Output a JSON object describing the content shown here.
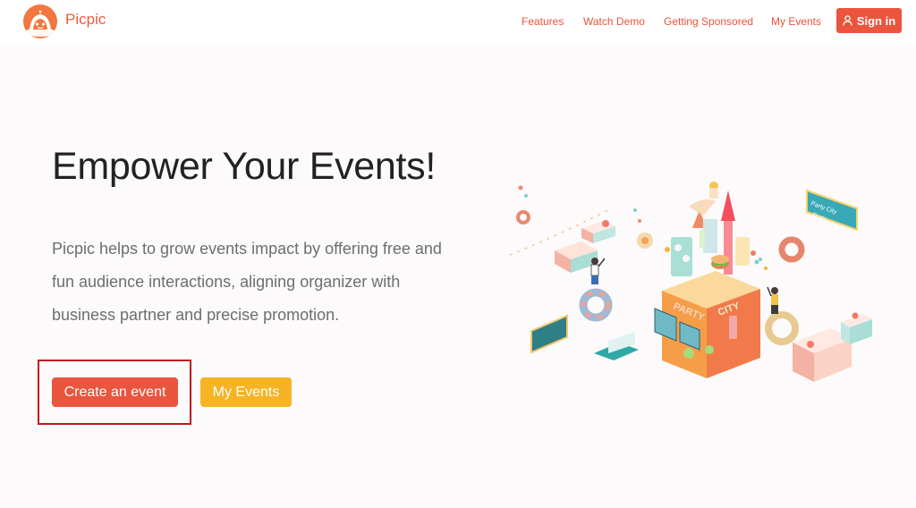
{
  "brand": {
    "name": "Picpic",
    "logo_icon": "picpic-logo-icon"
  },
  "nav": {
    "links": [
      "Features",
      "Watch Demo",
      "Getting Sponsored",
      "My Events"
    ],
    "signin_label": "Sign in",
    "signin_icon": "user-icon"
  },
  "hero": {
    "title": "Empower Your Events!",
    "description_lines": [
      "Picpic helps to grow events impact by offering free and",
      "fun audience interactions, aligning organizer with",
      "business partner and precise promotion."
    ],
    "create_button": "Create an event",
    "my_events_button": "My Events"
  },
  "illustration": {
    "sign_lines": [
      "Party City",
      "Picpic"
    ],
    "building_words": [
      "PARTY",
      "CITY"
    ]
  },
  "colors": {
    "accent": "#eb553e",
    "secondary": "#f6b323",
    "highlight_box": "#c3171e",
    "background": "#fcfafa"
  }
}
